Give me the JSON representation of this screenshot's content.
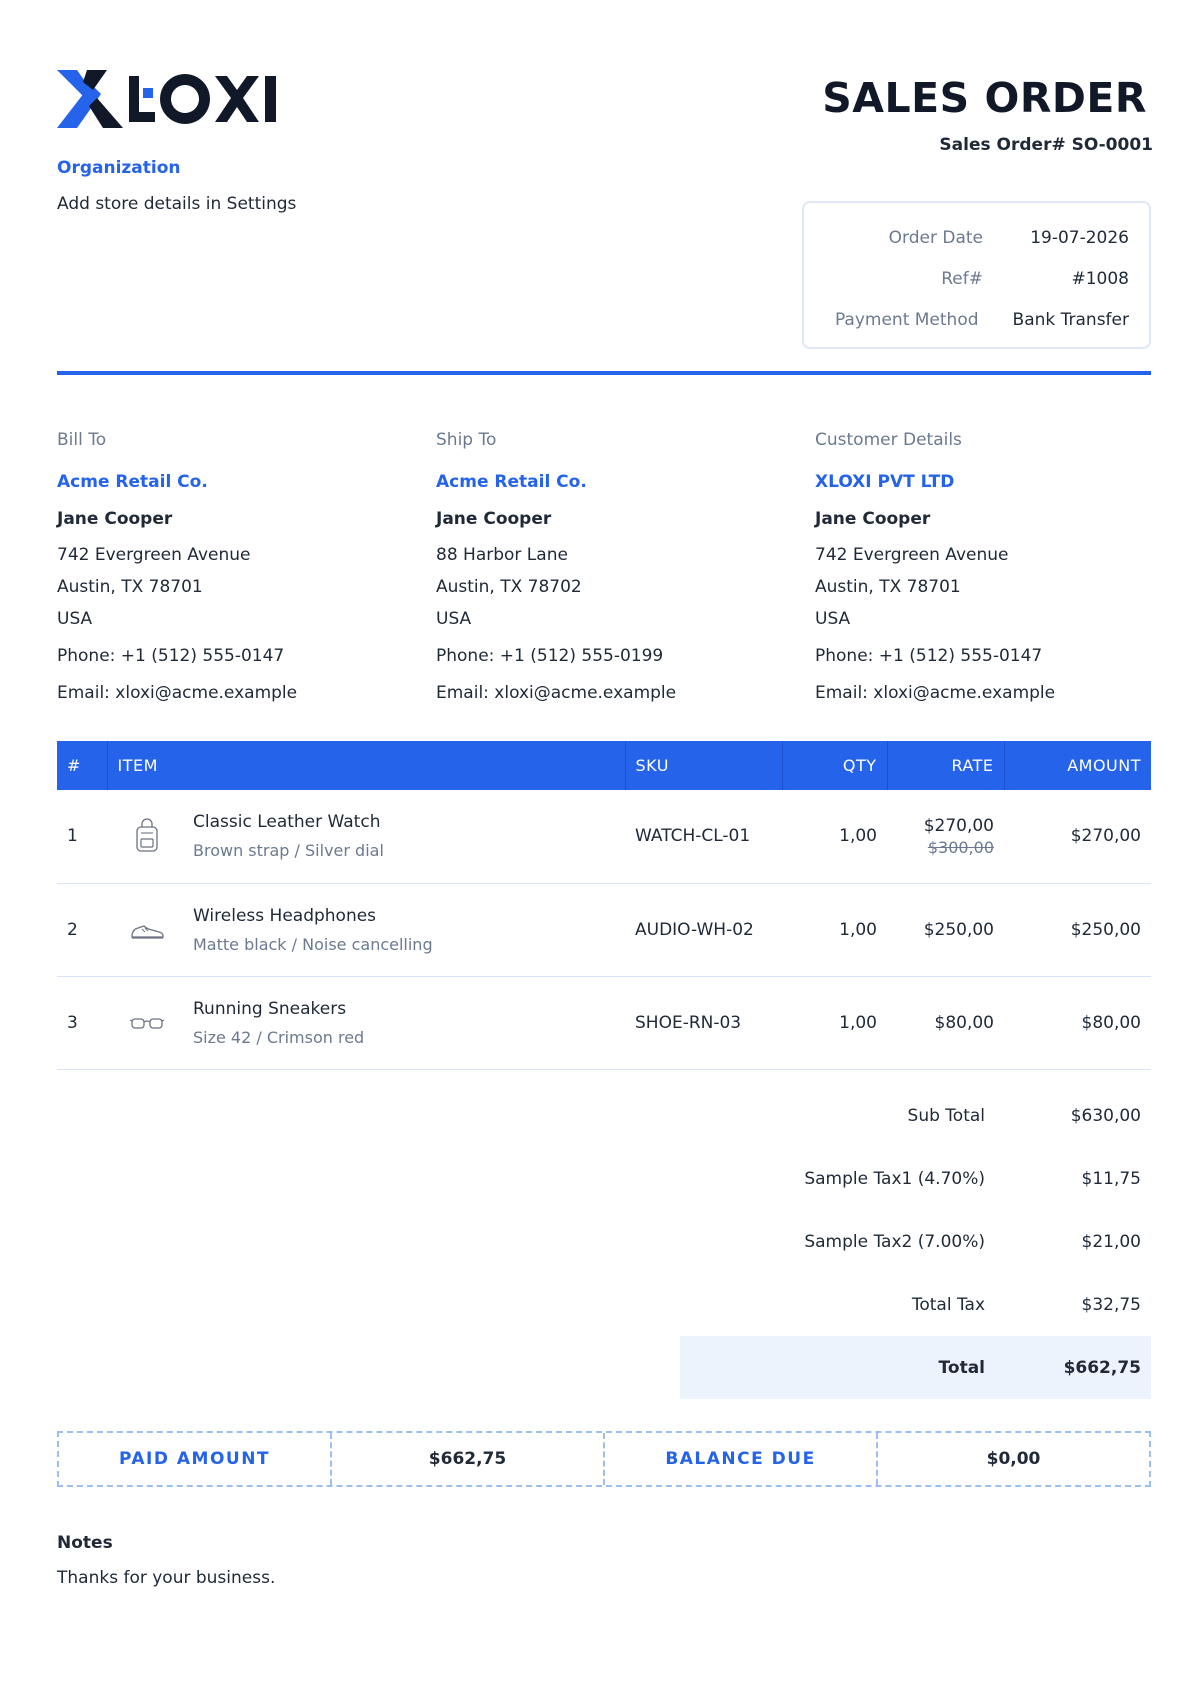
{
  "brand": {
    "logo_text": "XLOXI",
    "accent": "#2563eb",
    "dark": "#111827"
  },
  "header": {
    "title": "SALES ORDER",
    "number_label": "Sales Order#",
    "number": "SO-0001",
    "number_full": "Sales Order# SO-0001"
  },
  "organization": {
    "label": "Organization",
    "text": "Add store details in Settings"
  },
  "meta": [
    {
      "key": "Order Date",
      "value": "19-07-2026"
    },
    {
      "key": "Ref#",
      "value": "#1008"
    },
    {
      "key": "Payment Method",
      "value": "Bank Transfer"
    }
  ],
  "bill_to": {
    "heading": "Bill To",
    "company": "Acme Retail Co.",
    "person": "Jane Cooper",
    "street": "742 Evergreen Avenue",
    "city": "Austin, TX 78701",
    "country": "USA",
    "phone": "Phone: +1 (512) 555-0147",
    "email": "Email: xloxi@acme.example"
  },
  "ship_to": {
    "heading": "Ship To",
    "company": "Acme Retail Co.",
    "person": "Jane Cooper",
    "street": "88 Harbor Lane",
    "city": "Austin, TX 78702",
    "country": "USA",
    "phone": "Phone: +1 (512) 555-0199",
    "email": "Email: xloxi@acme.example"
  },
  "customer": {
    "heading": "Customer Details",
    "company": "XLOXI PVT LTD",
    "person": "Jane Cooper",
    "street": "742 Evergreen Avenue",
    "city": "Austin, TX 78701",
    "country": "USA",
    "phone": "Phone: +1 (512) 555-0147",
    "email": "Email: xloxi@acme.example"
  },
  "table": {
    "headers": {
      "num": "#",
      "item": "ITEM",
      "sku": "SKU",
      "qty": "QTY",
      "rate": "RATE",
      "amount": "AMOUNT"
    },
    "rows": [
      {
        "num": "1",
        "icon": "backpack-icon",
        "name": "Classic Leather Watch",
        "desc": "Brown strap / Silver dial",
        "sku": "WATCH-CL-01",
        "qty": "1,00",
        "rate": "$270,00",
        "rate_old": "$300,00",
        "amount": "$270,00"
      },
      {
        "num": "2",
        "icon": "sneaker-icon",
        "name": "Wireless Headphones",
        "desc": "Matte black / Noise cancelling",
        "sku": "AUDIO-WH-02",
        "qty": "1,00",
        "rate": "$250,00",
        "amount": "$250,00"
      },
      {
        "num": "3",
        "icon": "glasses-icon",
        "name": "Running Sneakers",
        "desc": "Size 42 / Crimson red",
        "sku": "SHOE-RN-03",
        "qty": "1,00",
        "rate": "$80,00",
        "amount": "$80,00"
      }
    ]
  },
  "totals": {
    "subtotal_label": "Sub Total",
    "subtotal": "$630,00",
    "tax1_label": "Sample Tax1 (4.70%)",
    "tax1": "$11,75",
    "tax2_label": "Sample Tax2 (7.00%)",
    "tax2": "$21,00",
    "total_tax_label": "Total Tax",
    "total_tax": "$32,75",
    "total_label": "Total",
    "total": "$662,75"
  },
  "payment": {
    "paid_label": "PAID AMOUNT",
    "paid": "$662,75",
    "balance_label": "BALANCE DUE",
    "balance": "$0,00"
  },
  "notes": {
    "heading": "Notes",
    "text": "Thanks for your business."
  }
}
